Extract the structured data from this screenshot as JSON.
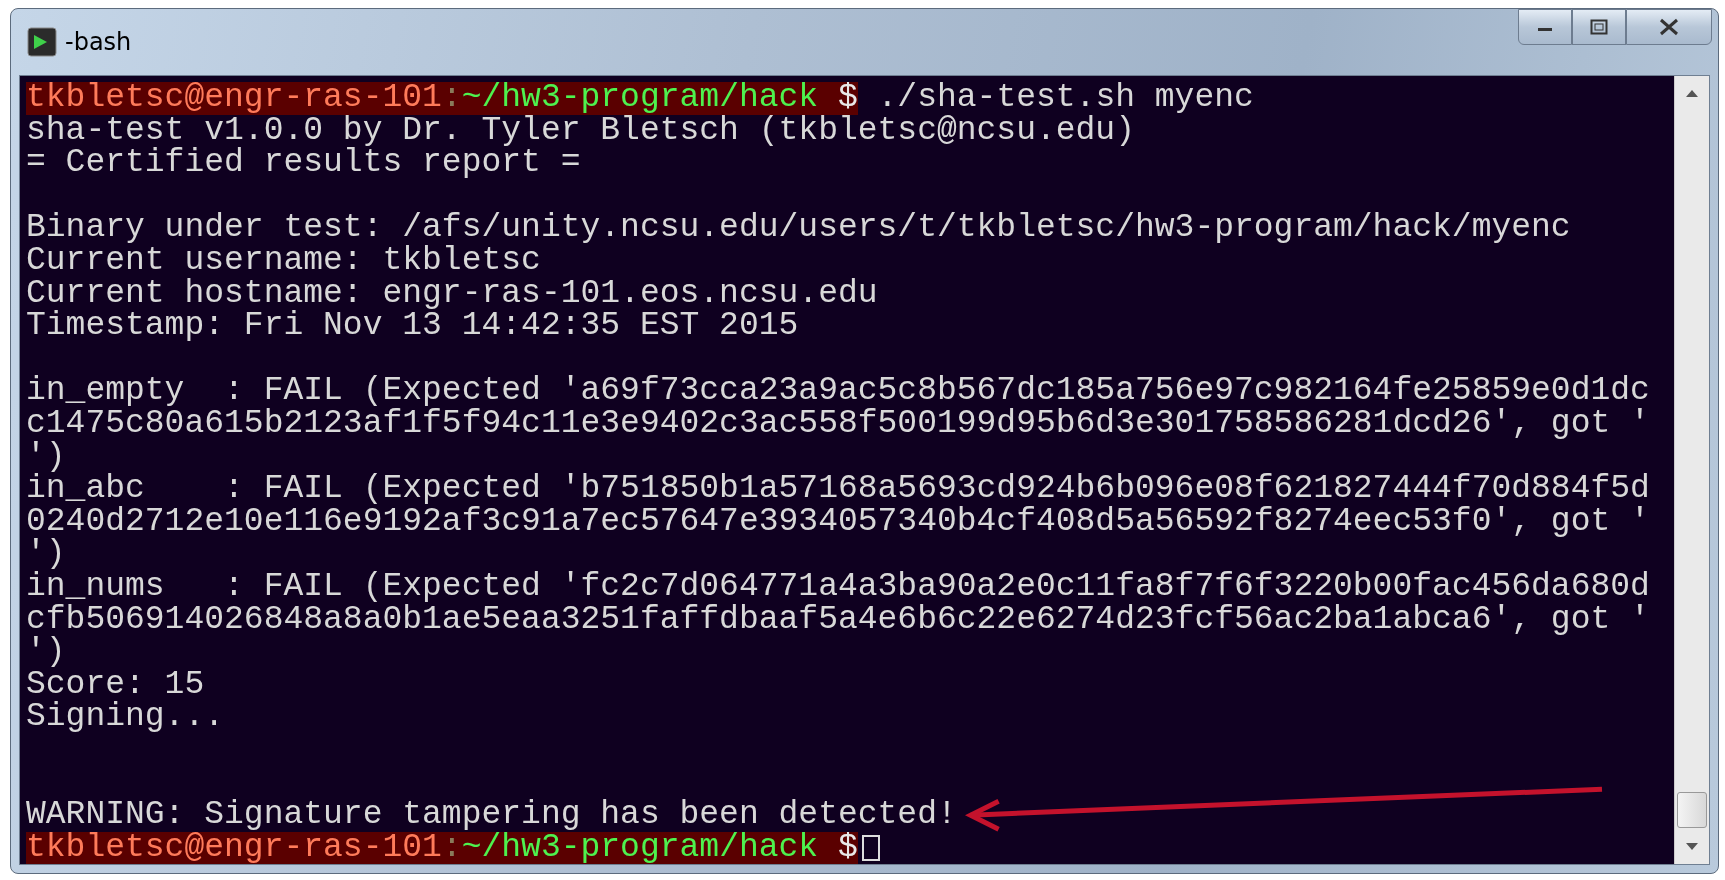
{
  "window": {
    "title": "-bash"
  },
  "terminal": {
    "lines": [
      {
        "kind": "prompt",
        "user": "tkbletsc@engr-ras-101",
        "separator": ":",
        "path": "~/hw3-program/hack",
        "symbol": "$",
        "command": "./sha-test.sh myenc",
        "cursor": false
      },
      {
        "kind": "text",
        "text": "sha-test v1.0.0 by Dr. Tyler Bletsch (tkbletsc@ncsu.edu)"
      },
      {
        "kind": "text",
        "text": "= Certified results report ="
      },
      {
        "kind": "blank"
      },
      {
        "kind": "text",
        "text": "Binary under test: /afs/unity.ncsu.edu/users/t/tkbletsc/hw3-program/hack/myenc"
      },
      {
        "kind": "text",
        "text": "Current username: tkbletsc"
      },
      {
        "kind": "text",
        "text": "Current hostname: engr-ras-101.eos.ncsu.edu"
      },
      {
        "kind": "text",
        "text": "Timestamp: Fri Nov 13 14:42:35 EST 2015"
      },
      {
        "kind": "blank"
      },
      {
        "kind": "text",
        "text": "in_empty  : FAIL (Expected 'a69f73cca23a9ac5c8b567dc185a756e97c982164fe25859e0d1dc"
      },
      {
        "kind": "text",
        "text": "c1475c80a615b2123af1f5f94c11e3e9402c3ac558f500199d95b6d3e301758586281dcd26', got '"
      },
      {
        "kind": "text",
        "text": "')"
      },
      {
        "kind": "text",
        "text": "in_abc    : FAIL (Expected 'b751850b1a57168a5693cd924b6b096e08f621827444f70d884f5d"
      },
      {
        "kind": "text",
        "text": "0240d2712e10e116e9192af3c91a7ec57647e3934057340b4cf408d5a56592f8274eec53f0', got '"
      },
      {
        "kind": "text",
        "text": "')"
      },
      {
        "kind": "text",
        "text": "in_nums   : FAIL (Expected 'fc2c7d064771a4a3ba90a2e0c11fa8f7f6f3220b00fac456da680d"
      },
      {
        "kind": "text",
        "text": "cfb506914026848a8a0b1ae5eaa3251faffdbaaf5a4e6b6c22e6274d23fcf56ac2ba1abca6', got '"
      },
      {
        "kind": "text",
        "text": "')"
      },
      {
        "kind": "text",
        "text": "Score: 15"
      },
      {
        "kind": "text",
        "text": "Signing..."
      },
      {
        "kind": "blank"
      },
      {
        "kind": "blank"
      },
      {
        "kind": "text",
        "text": "WARNING: Signature tampering has been detected!",
        "annotated": true
      },
      {
        "kind": "prompt",
        "user": "tkbletsc@engr-ras-101",
        "separator": ":",
        "path": "~/hw3-program/hack",
        "symbol": "$",
        "cursor": true
      }
    ]
  }
}
